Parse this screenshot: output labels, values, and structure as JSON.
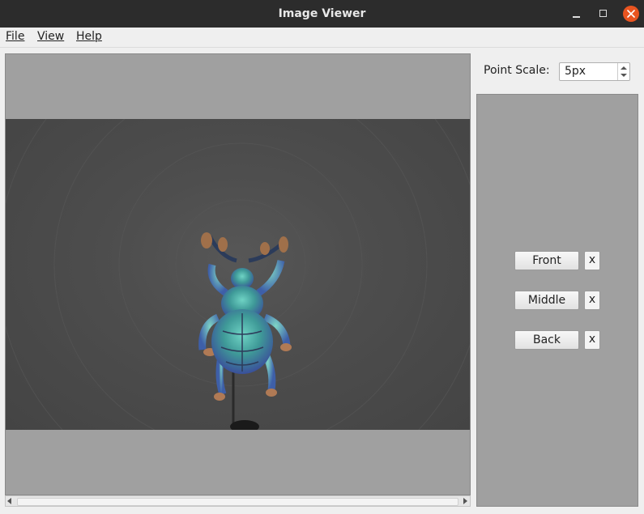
{
  "window": {
    "title": "Image Viewer",
    "controls": [
      "minimize-icon",
      "maximize-icon",
      "close-icon"
    ],
    "close_color": "#e95420"
  },
  "menu": {
    "file": "File",
    "view": "View",
    "help": "Help"
  },
  "image_view": {
    "background": "#a0a0a0",
    "photo_background": "#4d4d4d"
  },
  "controls": {
    "point_scale_label": "Point Scale:",
    "point_scale_value": "5px"
  },
  "views": [
    {
      "label": "Front",
      "remove": "x"
    },
    {
      "label": "Middle",
      "remove": "x"
    },
    {
      "label": "Back",
      "remove": "x"
    }
  ]
}
